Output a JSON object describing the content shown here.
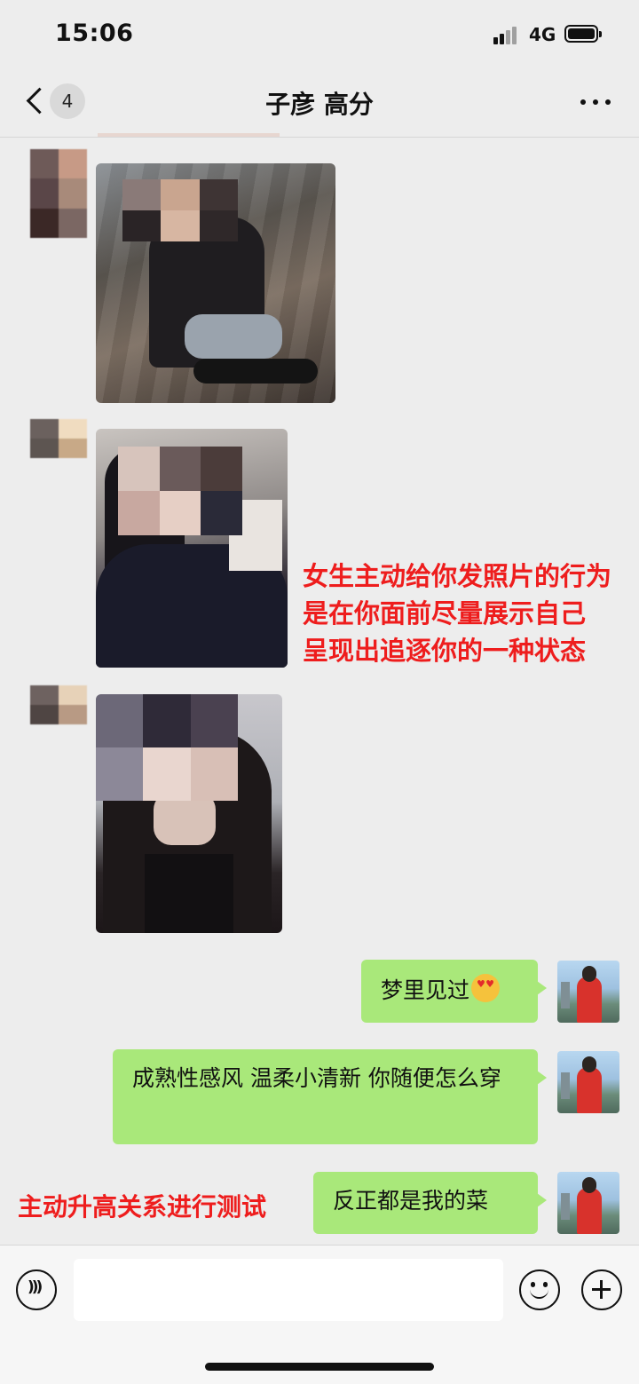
{
  "status_bar": {
    "time": "15:06",
    "network": "4G"
  },
  "header": {
    "unread_count": "4",
    "title": "子彦 高分"
  },
  "messages": {
    "m1": "梦里见过",
    "m2": "成熟性感风 温柔小清新 你随便怎么穿",
    "m3": "反正都是我的菜"
  },
  "annotations": {
    "note1": [
      "女生主动给你发照片的行为",
      "是在你面前尽量展示自己",
      "呈现出追逐你的一种状态"
    ],
    "note2": "主动升高关系进行测试"
  },
  "icons": {
    "back": "chevron-left-icon",
    "more": "more-dots-icon",
    "voice": "voice-icon",
    "emoji": "emoji-icon",
    "plus": "plus-icon",
    "emoji_in_message": "heart-eyes-emoji"
  },
  "colors": {
    "bubble_green": "#a9e87a",
    "annotation_red": "#ee1d1d",
    "background": "#ededed"
  }
}
